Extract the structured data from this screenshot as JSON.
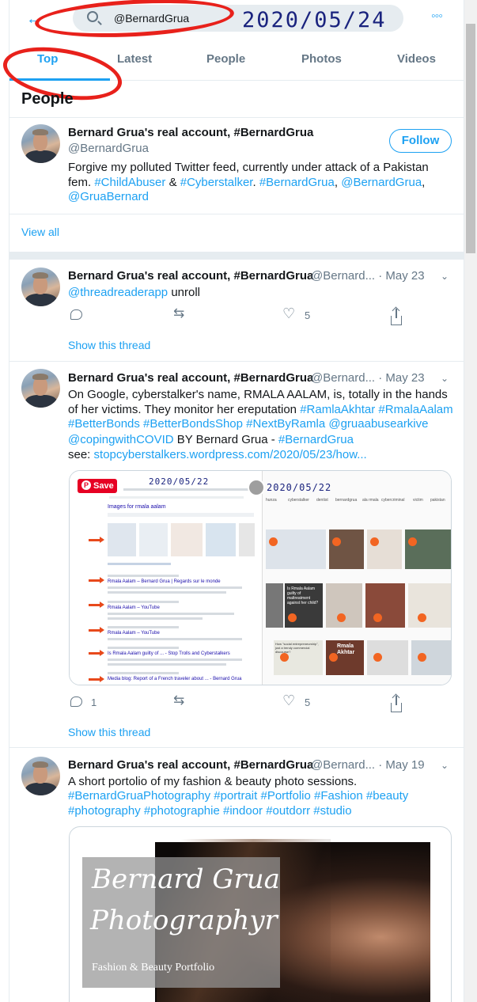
{
  "search": {
    "query": "@BernardGrua"
  },
  "stamp_date": "2020/05/24",
  "tabs": [
    "Top",
    "Latest",
    "People",
    "Photos",
    "Videos"
  ],
  "people": {
    "heading": "People",
    "name": "Bernard Grua's real account, #BernardGrua",
    "handle": "@BernardGrua",
    "follow": "Follow",
    "bio_line1": "Forgive my polluted Twitter feed, currently under attack of a Pakistan",
    "bio_l2_a": "fem. ",
    "bio_l2_b": "#ChildAbuser",
    "bio_l2_c": " & ",
    "bio_l2_d": "#Cyberstalker",
    "bio_l2_e": ". ",
    "bio_l2_f": "#BernardGrua",
    "bio_l2_g": ", ",
    "bio_l2_h": "@BernardGrua",
    "bio_l2_i": ",",
    "bio_line3": "@GruaBernard",
    "view_all": "View all"
  },
  "tweets": [
    {
      "name": "Bernard Grua's real account, #BernardGrua",
      "handle_date": "@Bernard... · May 23",
      "mention": "@threadreaderapp",
      "text": " unroll",
      "likes": "5",
      "show_thread": "Show this thread"
    },
    {
      "name": "Bernard Grua's real account, #BernardGrua",
      "handle_date": "@Bernard... · May 23",
      "l1": "On Google, cyberstalker's name, RMALA AALAM, is, totally in the hands",
      "l2_a": "of her victims. They monitor her ereputation ",
      "l2_b": "#RamlaAkhtar",
      "l2_c": " ",
      "l2_d": "#RmalaAalam",
      "l3": "#BetterBonds #BetterBondsShop #NextByRamla @gruaabusearkive",
      "l4_a": "@copingwithCOVID",
      "l4_b": "  BY Bernard Grua - ",
      "l4_c": "#BernardGrua",
      "l5_a": "see: ",
      "l5_b": "stopcyberstalkers.wordpress.com/2020/05/23/how...",
      "replies": "1",
      "likes": "5",
      "show_thread": "Show this thread",
      "media": {
        "save": "Save",
        "stamp": "2020/05/22",
        "images_for": "Images for rmala aalam",
        "results": [
          "Rmala Aalam – Bernard Grua | Regards sur le monde",
          "Rmala Aalam – YouTube",
          "Rmala Aalam – YouTube",
          "Is Rmala Aalam guilty of ... - Stop Trolls and Cyberstalkers",
          "Media blog: Report of a French traveler about ... - Bernard Grua"
        ],
        "right_chips": [
          "hunza",
          "cyberstalker",
          "dentist",
          "bernardgrua",
          "ala rmala",
          "cybercriminal",
          "victim",
          "pakistan"
        ],
        "tile_texts": [
          "Is Rmala Aalam guilty of maltreatment against her child?",
          "Rmala Akhtar",
          "How \"social entrepreneurship\", just a trendy commercial discourse?"
        ]
      }
    },
    {
      "name": "Bernard Grua's real account, #BernardGrua",
      "handle_date": "@Bernard... · May 19",
      "l1": "A short portolio of my fashion & beauty photo sessions.",
      "l2": "#BernardGruaPhotography #portrait #Portfolio #Fashion #beauty",
      "l3": "#photography #photographie #indoor #outdorr #studio",
      "media": {
        "script1": "Bernard Grua",
        "script2": "Photographyr",
        "portfolio": "Fashion & Beauty Portfolio"
      }
    }
  ],
  "colors": {
    "accent": "#1da1f2",
    "annotation_red": "#e8211b",
    "stamp_blue": "#1a237e"
  }
}
